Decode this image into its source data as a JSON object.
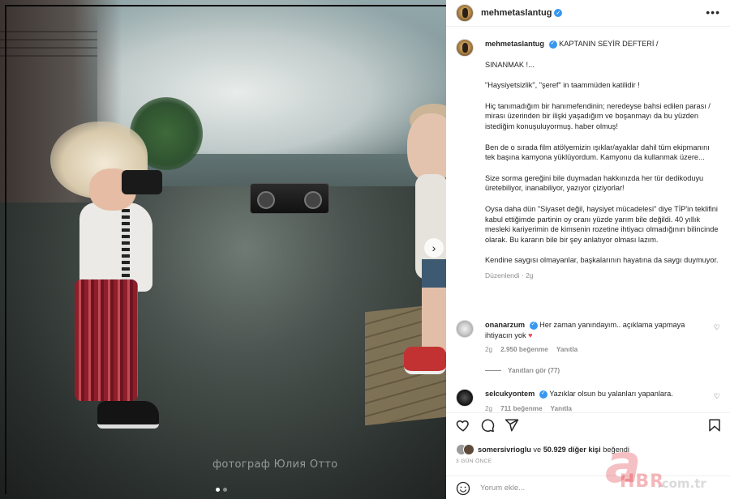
{
  "photo": {
    "watermark": "фотограф Юлия Отто",
    "carousel_dots": 2,
    "active_slide": 1
  },
  "post": {
    "username": "mehmetaslantug",
    "more_label": "•••",
    "caption": {
      "username": "mehmetaslantug",
      "title": "KAPTANIN SEYİR DEFTERİ /",
      "paragraphs": [
        "SINANMAK !...",
        "\"Haysiyetsizlik\", \"şeref\" in taammüden katilidir !",
        "Hiç tanımadığım bir hanımefendinin; neredeyse bahsi edilen parası / mirası üzerinden bir ilişki yaşadığım ve boşanmayı da bu yüzden istediğim konuşuluyormuş. haber olmuş!",
        "Ben de o sırada film atölyemizin ışıklar/ayaklar dahil tüm ekipmanını tek başına kamyona yüklüyordum. Kamyonu da kullanmak üzere...",
        "Size sorma gereğini bile duymadan hakkınızda her tür dedikoduyu üretebiliyor, inanabiliyor, yazıyor çiziyorlar!",
        "Oysa daha dün \"Siyaset değil, haysiyet mücadelesi\" diye TİP'in teklifini kabul ettiğimde partinin oy oranı yüzde yarım bile değildi. 40 yıllık mesleki kariyerimin de kimsenin rozetine ihtiyacı olmadığının bilincinde olarak. Bu kararın bile bir şey anlatıyor olması lazım.",
        "Kendine saygısı olmayanlar, başkalarının hayatına da saygı duymuyor."
      ],
      "meta": "Düzenlendi · 2g"
    },
    "comments": [
      {
        "username": "onanarzum",
        "text": "Her zaman yanındayım.. açıklama yapmaya ihtiyacın yok",
        "time": "2g",
        "likes": "2.950 beğenme",
        "reply": "Yanıtla"
      },
      {
        "username": "selcukyontem",
        "text": "Yazıklar olsun bu yalanları yapanlara.",
        "time": "2g",
        "likes": "711 beğenme",
        "reply": "Yanıtla"
      }
    ],
    "view_replies": "Yanıtları gör (77)",
    "liked_by": {
      "user": "somersivrioglu",
      "connector": " ve ",
      "others": "50.929 diğer kişi",
      "suffix": " beğendi"
    },
    "time_ago": "3 GÜN ÖNCE",
    "comment_placeholder": "Yorum ekle..."
  },
  "icons": {
    "like": "heart-icon",
    "comment": "comment-icon",
    "share": "share-icon",
    "save": "bookmark-icon",
    "emoji": "emoji-icon"
  },
  "colors": {
    "verified": "#3897f0",
    "heart": "#ed4956",
    "muted": "#8e8e8e"
  },
  "logo": {
    "letter": "a",
    "brand": "HBR",
    "domain": ".com.tr"
  }
}
